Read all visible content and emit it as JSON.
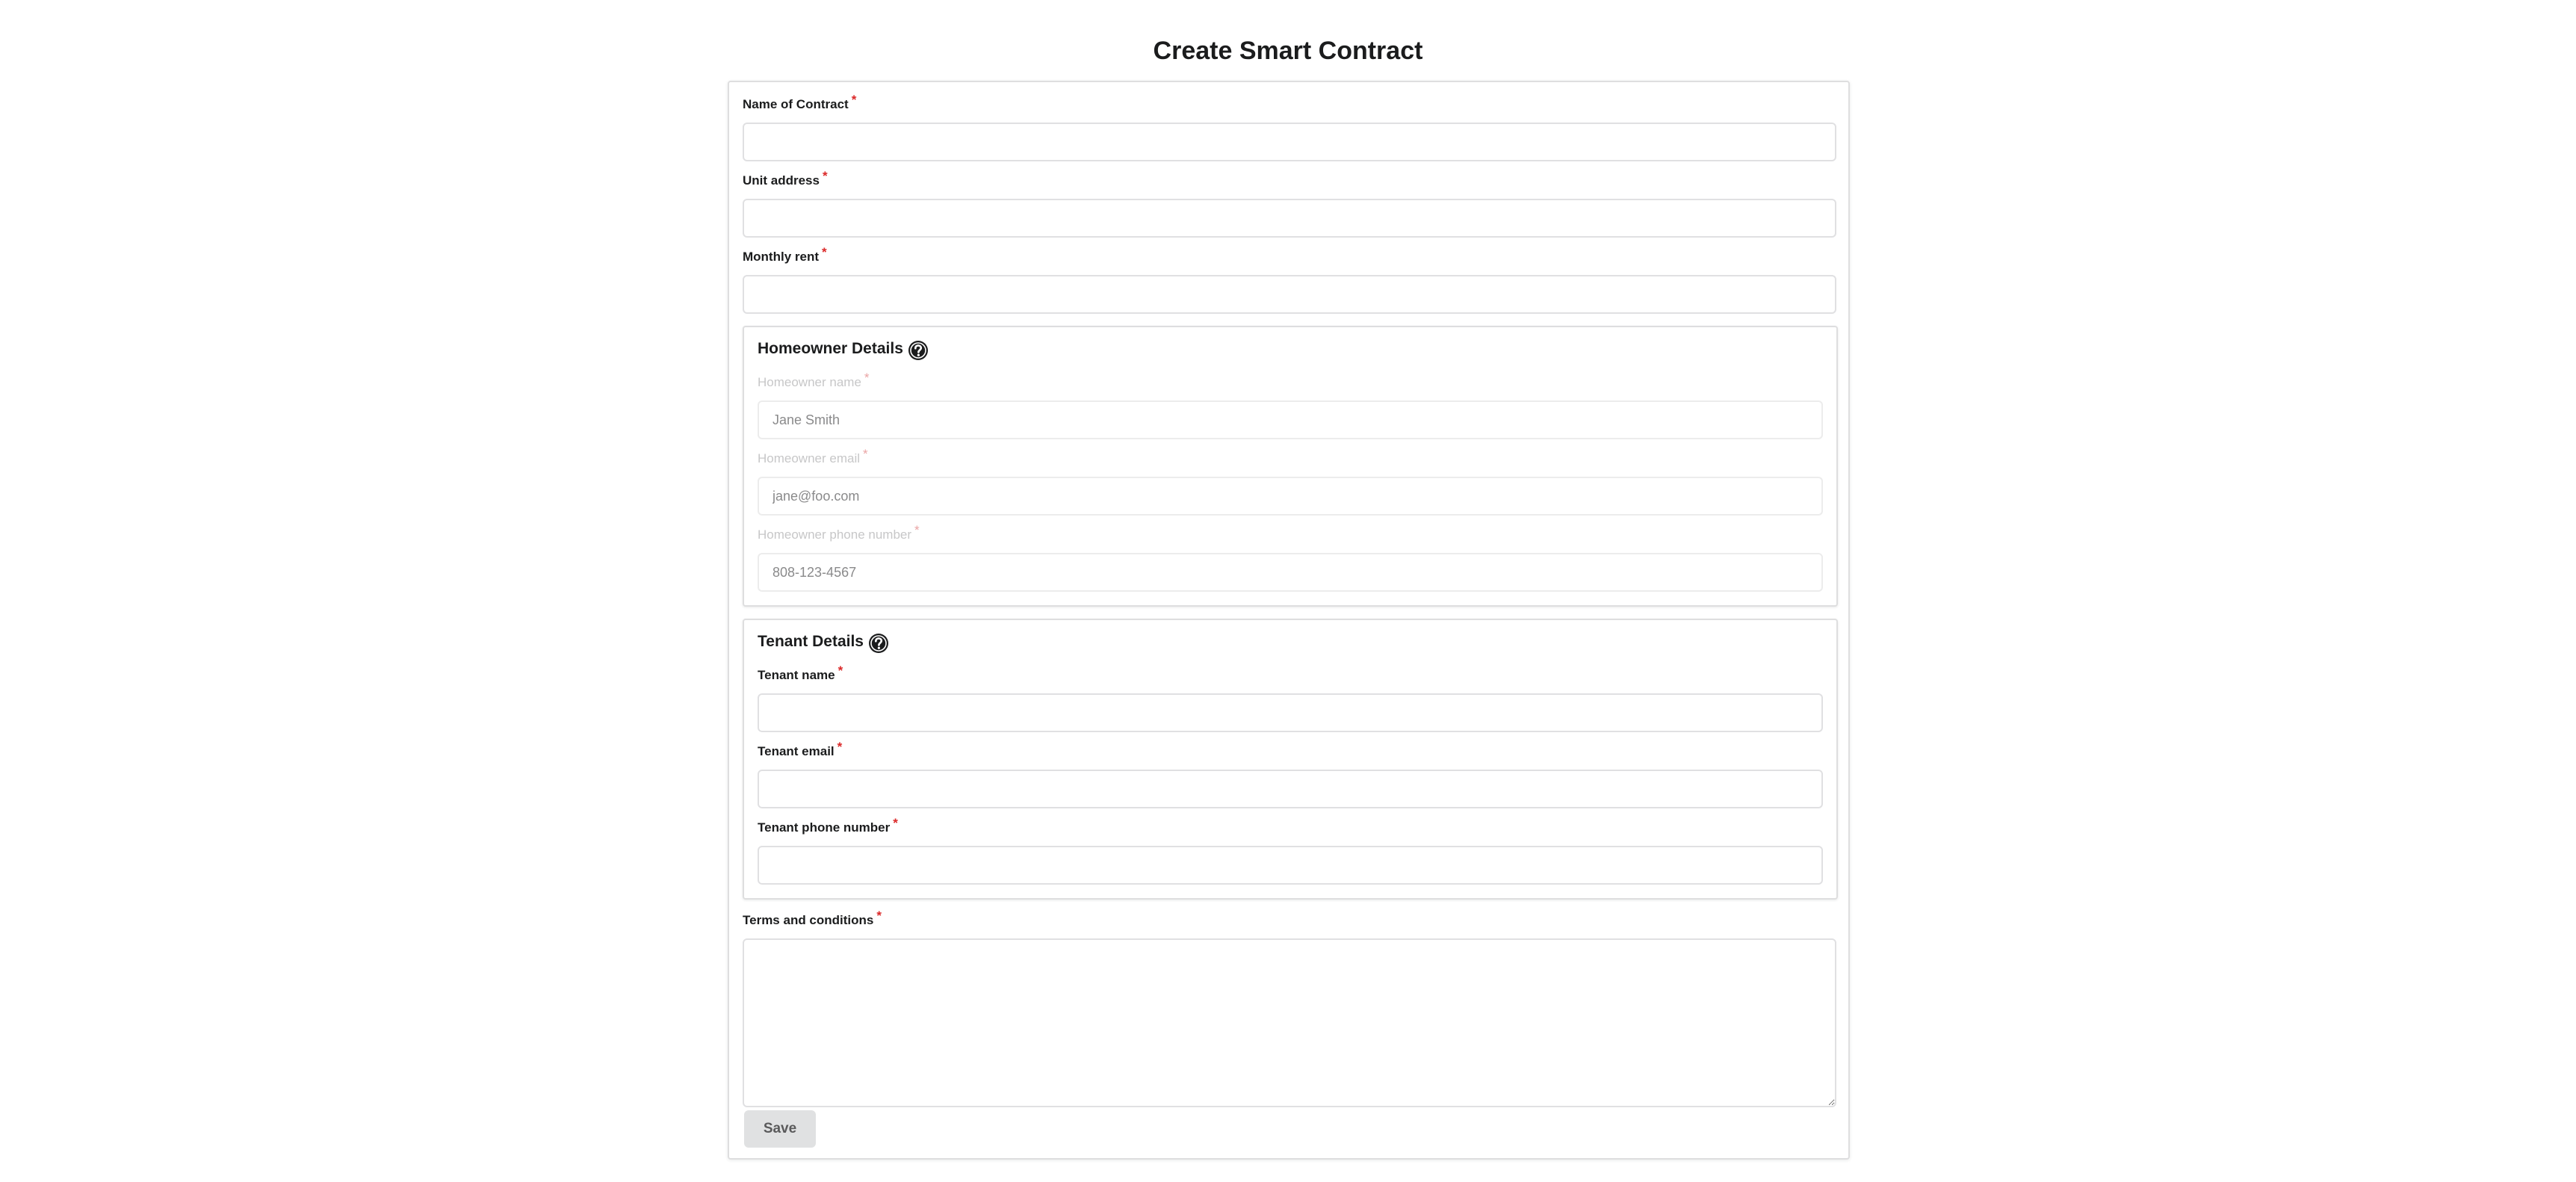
{
  "page": {
    "title": "Create Smart Contract"
  },
  "required_marker": "*",
  "contract": {
    "name_label": "Name of Contract",
    "name_value": "",
    "address_label": "Unit address",
    "address_value": "",
    "rent_label": "Monthly rent",
    "rent_value": ""
  },
  "homeowner": {
    "section_title": "Homeowner Details",
    "help_icon": "question-circle-icon",
    "disabled": true,
    "name_label": "Homeowner name",
    "name_value": "Jane Smith",
    "email_label": "Homeowner email",
    "email_value": "jane@foo.com",
    "phone_label": "Homeowner phone number",
    "phone_value": "808-123-4567"
  },
  "tenant": {
    "section_title": "Tenant Details",
    "help_icon": "question-circle-icon",
    "name_label": "Tenant name",
    "name_value": "",
    "email_label": "Tenant email",
    "email_value": "",
    "phone_label": "Tenant phone number",
    "phone_value": ""
  },
  "terms": {
    "label": "Terms and conditions",
    "value": ""
  },
  "actions": {
    "save_label": "Save"
  },
  "colors": {
    "required_asterisk": "#db2828",
    "border": "#dededf",
    "button_bg": "#e0e1e2",
    "button_text": "#5a5a5b"
  }
}
